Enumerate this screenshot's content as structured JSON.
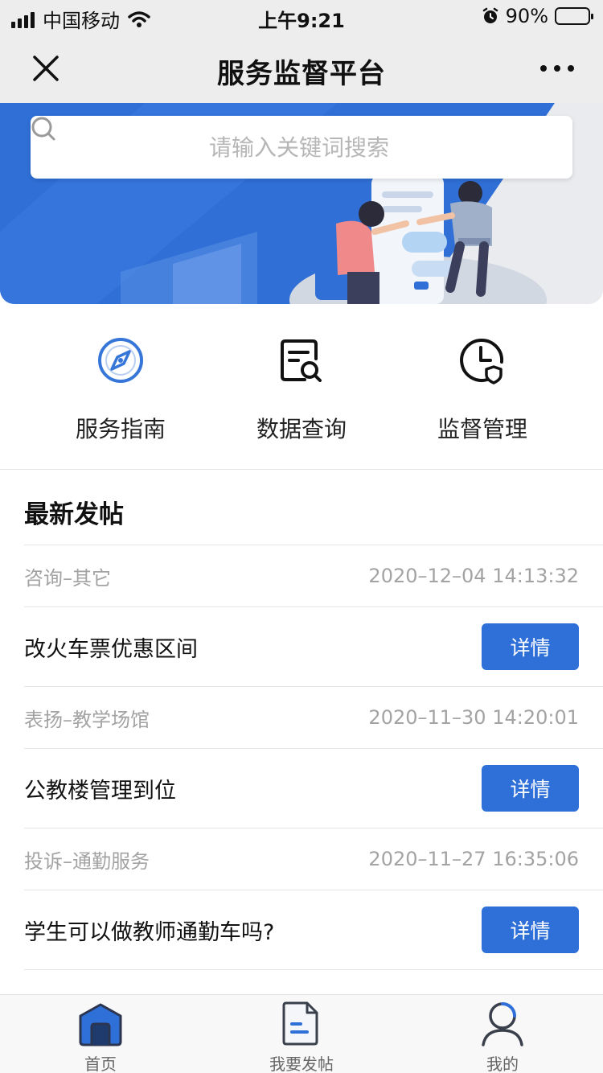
{
  "status_bar": {
    "carrier": "中国移动",
    "time": "上午9:21",
    "battery": "90%",
    "battery_level": 0.9
  },
  "nav": {
    "title": "服务监督平台"
  },
  "search": {
    "placeholder": "请输入关键词搜索"
  },
  "quick_entries": [
    {
      "label": "服务指南",
      "icon": "compass-icon"
    },
    {
      "label": "数据查询",
      "icon": "document-search-icon"
    },
    {
      "label": "监督管理",
      "icon": "clock-shield-icon"
    }
  ],
  "section": {
    "title": "最新发帖"
  },
  "posts": [
    {
      "category": "咨询–其它",
      "time": "2020–12–04 14:13:32",
      "title": "改火车票优惠区间",
      "action": "详情"
    },
    {
      "category": "表扬–教学场馆",
      "time": "2020–11–30 14:20:01",
      "title": "公教楼管理到位",
      "action": "详情"
    },
    {
      "category": "投诉–通勤服务",
      "time": "2020–11–27 16:35:06",
      "title": "学生可以做教师通勤车吗?",
      "action": "详情"
    }
  ],
  "tabs": [
    {
      "label": "首页",
      "icon": "home-icon",
      "active": true
    },
    {
      "label": "我要发帖",
      "icon": "post-icon",
      "active": false
    },
    {
      "label": "我的",
      "icon": "user-icon",
      "active": false
    }
  ],
  "colors": {
    "accent": "#2e6fd8",
    "nav_bg": "#ededed",
    "banner_blue": "#2f6fd6"
  }
}
